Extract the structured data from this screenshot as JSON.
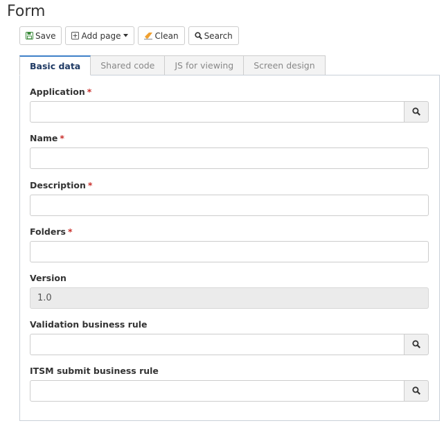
{
  "page": {
    "title": "Form"
  },
  "toolbar": {
    "save_label": "Save",
    "add_page_label": "Add page",
    "clean_label": "Clean",
    "search_label": "Search"
  },
  "tabs": [
    {
      "label": "Basic data",
      "active": true
    },
    {
      "label": "Shared code",
      "active": false
    },
    {
      "label": "JS for viewing",
      "active": false
    },
    {
      "label": "Screen design",
      "active": false
    }
  ],
  "form": {
    "required_marker": "*",
    "application": {
      "label": "Application",
      "required": true,
      "value": ""
    },
    "name": {
      "label": "Name",
      "required": true,
      "value": ""
    },
    "description": {
      "label": "Description",
      "required": true,
      "value": ""
    },
    "folders": {
      "label": "Folders",
      "required": true,
      "value": ""
    },
    "version": {
      "label": "Version",
      "required": false,
      "value": "1.0"
    },
    "validation_rule": {
      "label": "Validation business rule",
      "required": false,
      "value": ""
    },
    "itsm_rule": {
      "label": "ITSM submit business rule",
      "required": false,
      "value": ""
    }
  },
  "colors": {
    "accent": "#3d7fc8",
    "required": "#c9302c",
    "active_tab_text": "#1f3a64",
    "clean_icon": "#f0a030",
    "save_icon": "#3a8a3a"
  },
  "icons": {
    "save": "floppy-disk-icon",
    "add_page": "plus-square-icon",
    "add_page_caret": "caret-down-icon",
    "clean": "eraser-icon",
    "search": "magnifier-icon",
    "lookup": "magnifier-icon"
  }
}
